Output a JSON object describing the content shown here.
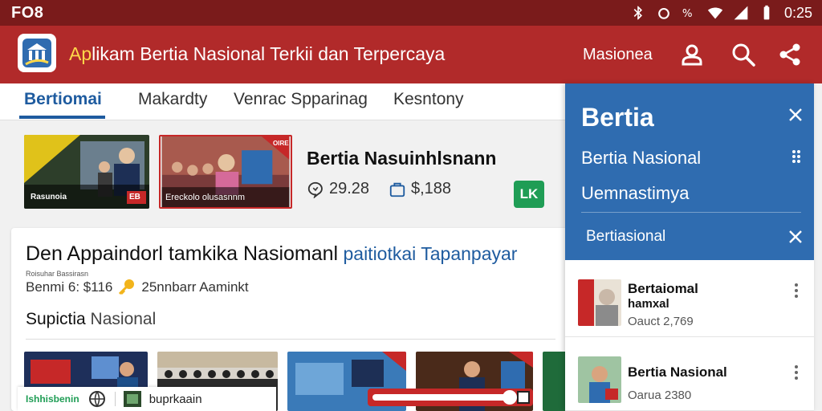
{
  "status_bar": {
    "left_text": "FO8",
    "time": "0:25",
    "icons": [
      "bluetooth-icon",
      "alarm-icon",
      "vibrate-icon",
      "wifi-icon",
      "signal-icon",
      "battery-icon"
    ]
  },
  "app_bar": {
    "title_accent": "Ap",
    "title_rest": "likam Bertia Nasional Terkii dan Terpercaya",
    "link_label": "Masionea",
    "icons": [
      "profile-icon",
      "search-icon",
      "share-icon"
    ]
  },
  "tabs": [
    {
      "label": "Bertiomai",
      "active": true
    },
    {
      "label": "Makardty",
      "active": false
    },
    {
      "label": "Venrac Spparinag",
      "active": false
    },
    {
      "label": "Kesntony",
      "active": false
    }
  ],
  "featured": {
    "title": "Bertia Nasuinhlsnann",
    "comments": "29.28",
    "shares": "$,188",
    "badge_label": "LK",
    "thumb1_caption": "Rasunoia",
    "thumb1_badge": "EB",
    "thumb2_caption": "Ereckolo olusasnnm",
    "thumb2_ribbon": "OIRE"
  },
  "article": {
    "headline": "Den Appaindorl tamkika Nasiomanl",
    "headline_blue": " paitiotkai Tapanpayar",
    "small_text": "Roisuhar Bassirasn",
    "byline_left": "Benmi 6: $116",
    "byline_right": "25nnbarr Aaminkt",
    "section_heading": "Supictia",
    "section_heading_plain": " Nasional"
  },
  "bottom_bar": {
    "left_label": "Ishhisbenin",
    "label": "buprkaain"
  },
  "side_panel": {
    "title": "Bertia",
    "item1": "Bertia Nasional",
    "item2": "Uemnastimya",
    "item3": "Bertiasional",
    "list": [
      {
        "title": "Bertaiomal",
        "subtitle": "hamxal",
        "meta": "Oauct 2,769"
      },
      {
        "title": "Bertia Nasional",
        "subtitle": "",
        "meta": "Oarua 2380"
      }
    ]
  },
  "colors": {
    "status_bar": "#7a1b1b",
    "app_bar": "#b12a2a",
    "accent_blue": "#1e5b9f",
    "panel_blue": "#2f6cb0",
    "badge_green": "#1f9d55"
  }
}
